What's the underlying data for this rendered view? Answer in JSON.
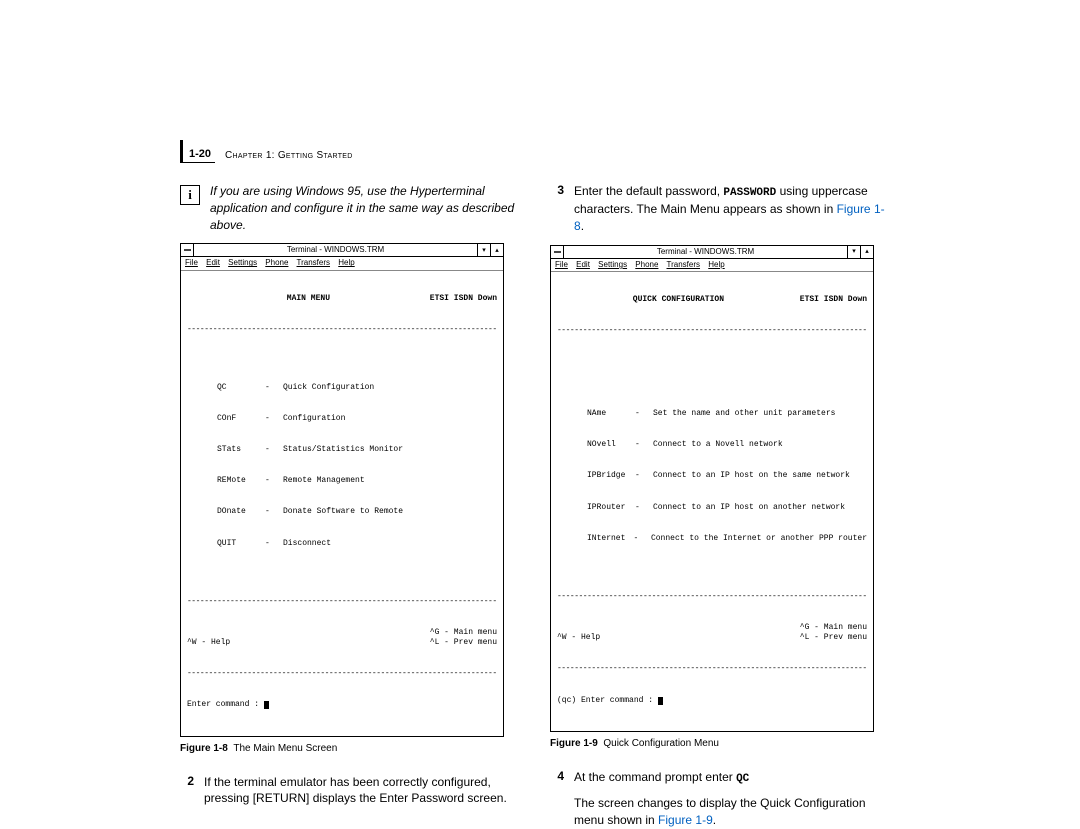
{
  "header": {
    "page_num": "1-20",
    "chapter": "Chapter 1: Getting Started"
  },
  "left": {
    "info_note": "If you are using Windows 95, use the Hyperterminal application and configure it in the same way as described above.",
    "terminal": {
      "title": "Terminal - WINDOWS.TRM",
      "menus": [
        "File",
        "Edit",
        "Settings",
        "Phone",
        "Transfers",
        "Help"
      ],
      "heading": "MAIN MENU",
      "status": "ETSI ISDN Down",
      "rows": [
        {
          "cmd": "QC",
          "desc": "Quick Configuration"
        },
        {
          "cmd": "COnF",
          "desc": "Configuration"
        },
        {
          "cmd": "STats",
          "desc": "Status/Statistics Monitor"
        },
        {
          "cmd": "REMote",
          "desc": "Remote Management"
        },
        {
          "cmd": "DOnate",
          "desc": "Donate Software to Remote"
        },
        {
          "cmd": "QUIT",
          "desc": "Disconnect"
        }
      ],
      "help": "^W - Help",
      "nav1": "^G - Main menu",
      "nav2": "^L - Prev menu",
      "prompt": "Enter command : "
    },
    "caption_label": "Figure 1-8",
    "caption_text": "The Main Menu Screen",
    "step2_num": "2",
    "step2": "If the terminal emulator has been correctly configured, pressing [RETURN] displays the Enter Password screen."
  },
  "right": {
    "step3_num": "3",
    "step3_a": "Enter the default password, ",
    "step3_pw": "PASSWORD",
    "step3_b": " using uppercase characters. The Main Menu appears as shown in ",
    "step3_link": "Figure 1-8",
    "step3_c": ".",
    "terminal": {
      "title": "Terminal - WINDOWS.TRM",
      "menus": [
        "File",
        "Edit",
        "Settings",
        "Phone",
        "Transfers",
        "Help"
      ],
      "heading": "QUICK CONFIGURATION",
      "status": "ETSI ISDN Down",
      "rows": [
        {
          "cmd": "NAme",
          "desc": "Set the name and other unit parameters"
        },
        {
          "cmd": "NOvell",
          "desc": "Connect to a Novell network"
        },
        {
          "cmd": "IPBridge",
          "desc": "Connect to an IP host on the same network"
        },
        {
          "cmd": "IPRouter",
          "desc": "Connect to an IP host on another network"
        },
        {
          "cmd": "INternet",
          "desc": "Connect to the Internet or another PPP router"
        }
      ],
      "help": "^W - Help",
      "nav1": "^G - Main menu",
      "nav2": "^L - Prev menu",
      "prompt": "(qc) Enter command : "
    },
    "caption_label": "Figure 1-9",
    "caption_text": "Quick Configuration Menu",
    "step4_num": "4",
    "step4_a": "At the command prompt enter ",
    "step4_cmd": "QC",
    "step5_a": "The screen changes to display the Quick Configuration menu shown in ",
    "step5_link": "Figure 1-9",
    "step5_c": "."
  }
}
